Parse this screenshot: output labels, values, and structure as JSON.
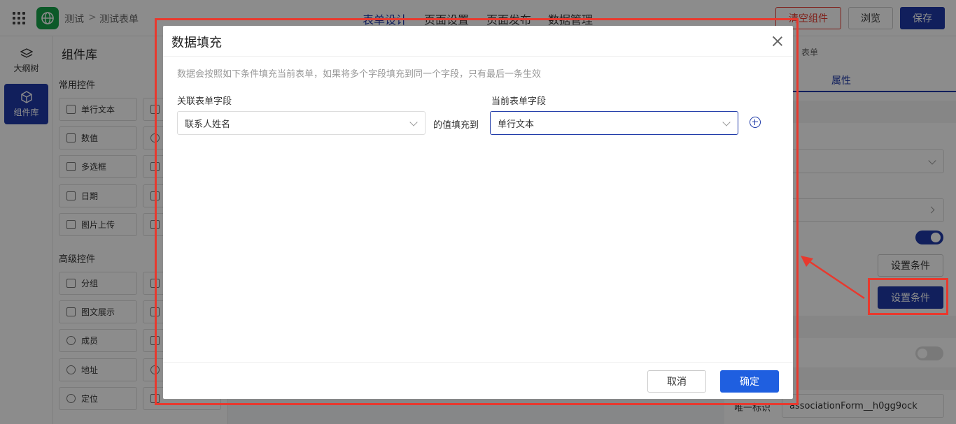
{
  "header": {
    "breadcrumb": [
      "测试",
      "测试表单"
    ],
    "breadcrumb_sep": ">",
    "tabs": [
      {
        "label": "表单设计",
        "active": true
      },
      {
        "label": "页面设置",
        "active": false
      },
      {
        "label": "页面发布",
        "active": false
      },
      {
        "label": "数据管理",
        "active": false
      }
    ],
    "clear_label": "清空组件",
    "preview_label": "浏览",
    "save_label": "保存"
  },
  "rail": {
    "items": [
      {
        "label": "大纲树",
        "icon": "layers-icon",
        "active": false
      },
      {
        "label": "组件库",
        "icon": "cube-icon",
        "active": true
      }
    ]
  },
  "components": {
    "title": "组件库",
    "common_title": "常用控件",
    "common": [
      "单行文本",
      "数值",
      "多选框",
      "日期",
      "图片上传"
    ],
    "advanced_title": "高级控件",
    "advanced": [
      "分组",
      "图文展示",
      "成员",
      "地址",
      "定位"
    ]
  },
  "right_panel": {
    "crumb": "表单",
    "tab": "属性",
    "set_condition_1": "设置条件",
    "set_condition_2": "设置条件",
    "unique_id_label": "唯一标识",
    "unique_id_value": "associationForm__h0gg9ock"
  },
  "dialog": {
    "title": "数据填充",
    "description": "数据会按照如下条件填充当前表单，如果将多个字段填充到同一个字段，只有最后一条生效",
    "left_label": "关联表单字段",
    "right_label": "当前表单字段",
    "left_value": "联系人姓名",
    "fill_to": "的值填充到",
    "right_value": "单行文本",
    "cancel_label": "取消",
    "ok_label": "确定"
  },
  "colors": {
    "primary": "#1f3aa8",
    "annotation": "#e8392e",
    "logo": "#17a34a"
  }
}
